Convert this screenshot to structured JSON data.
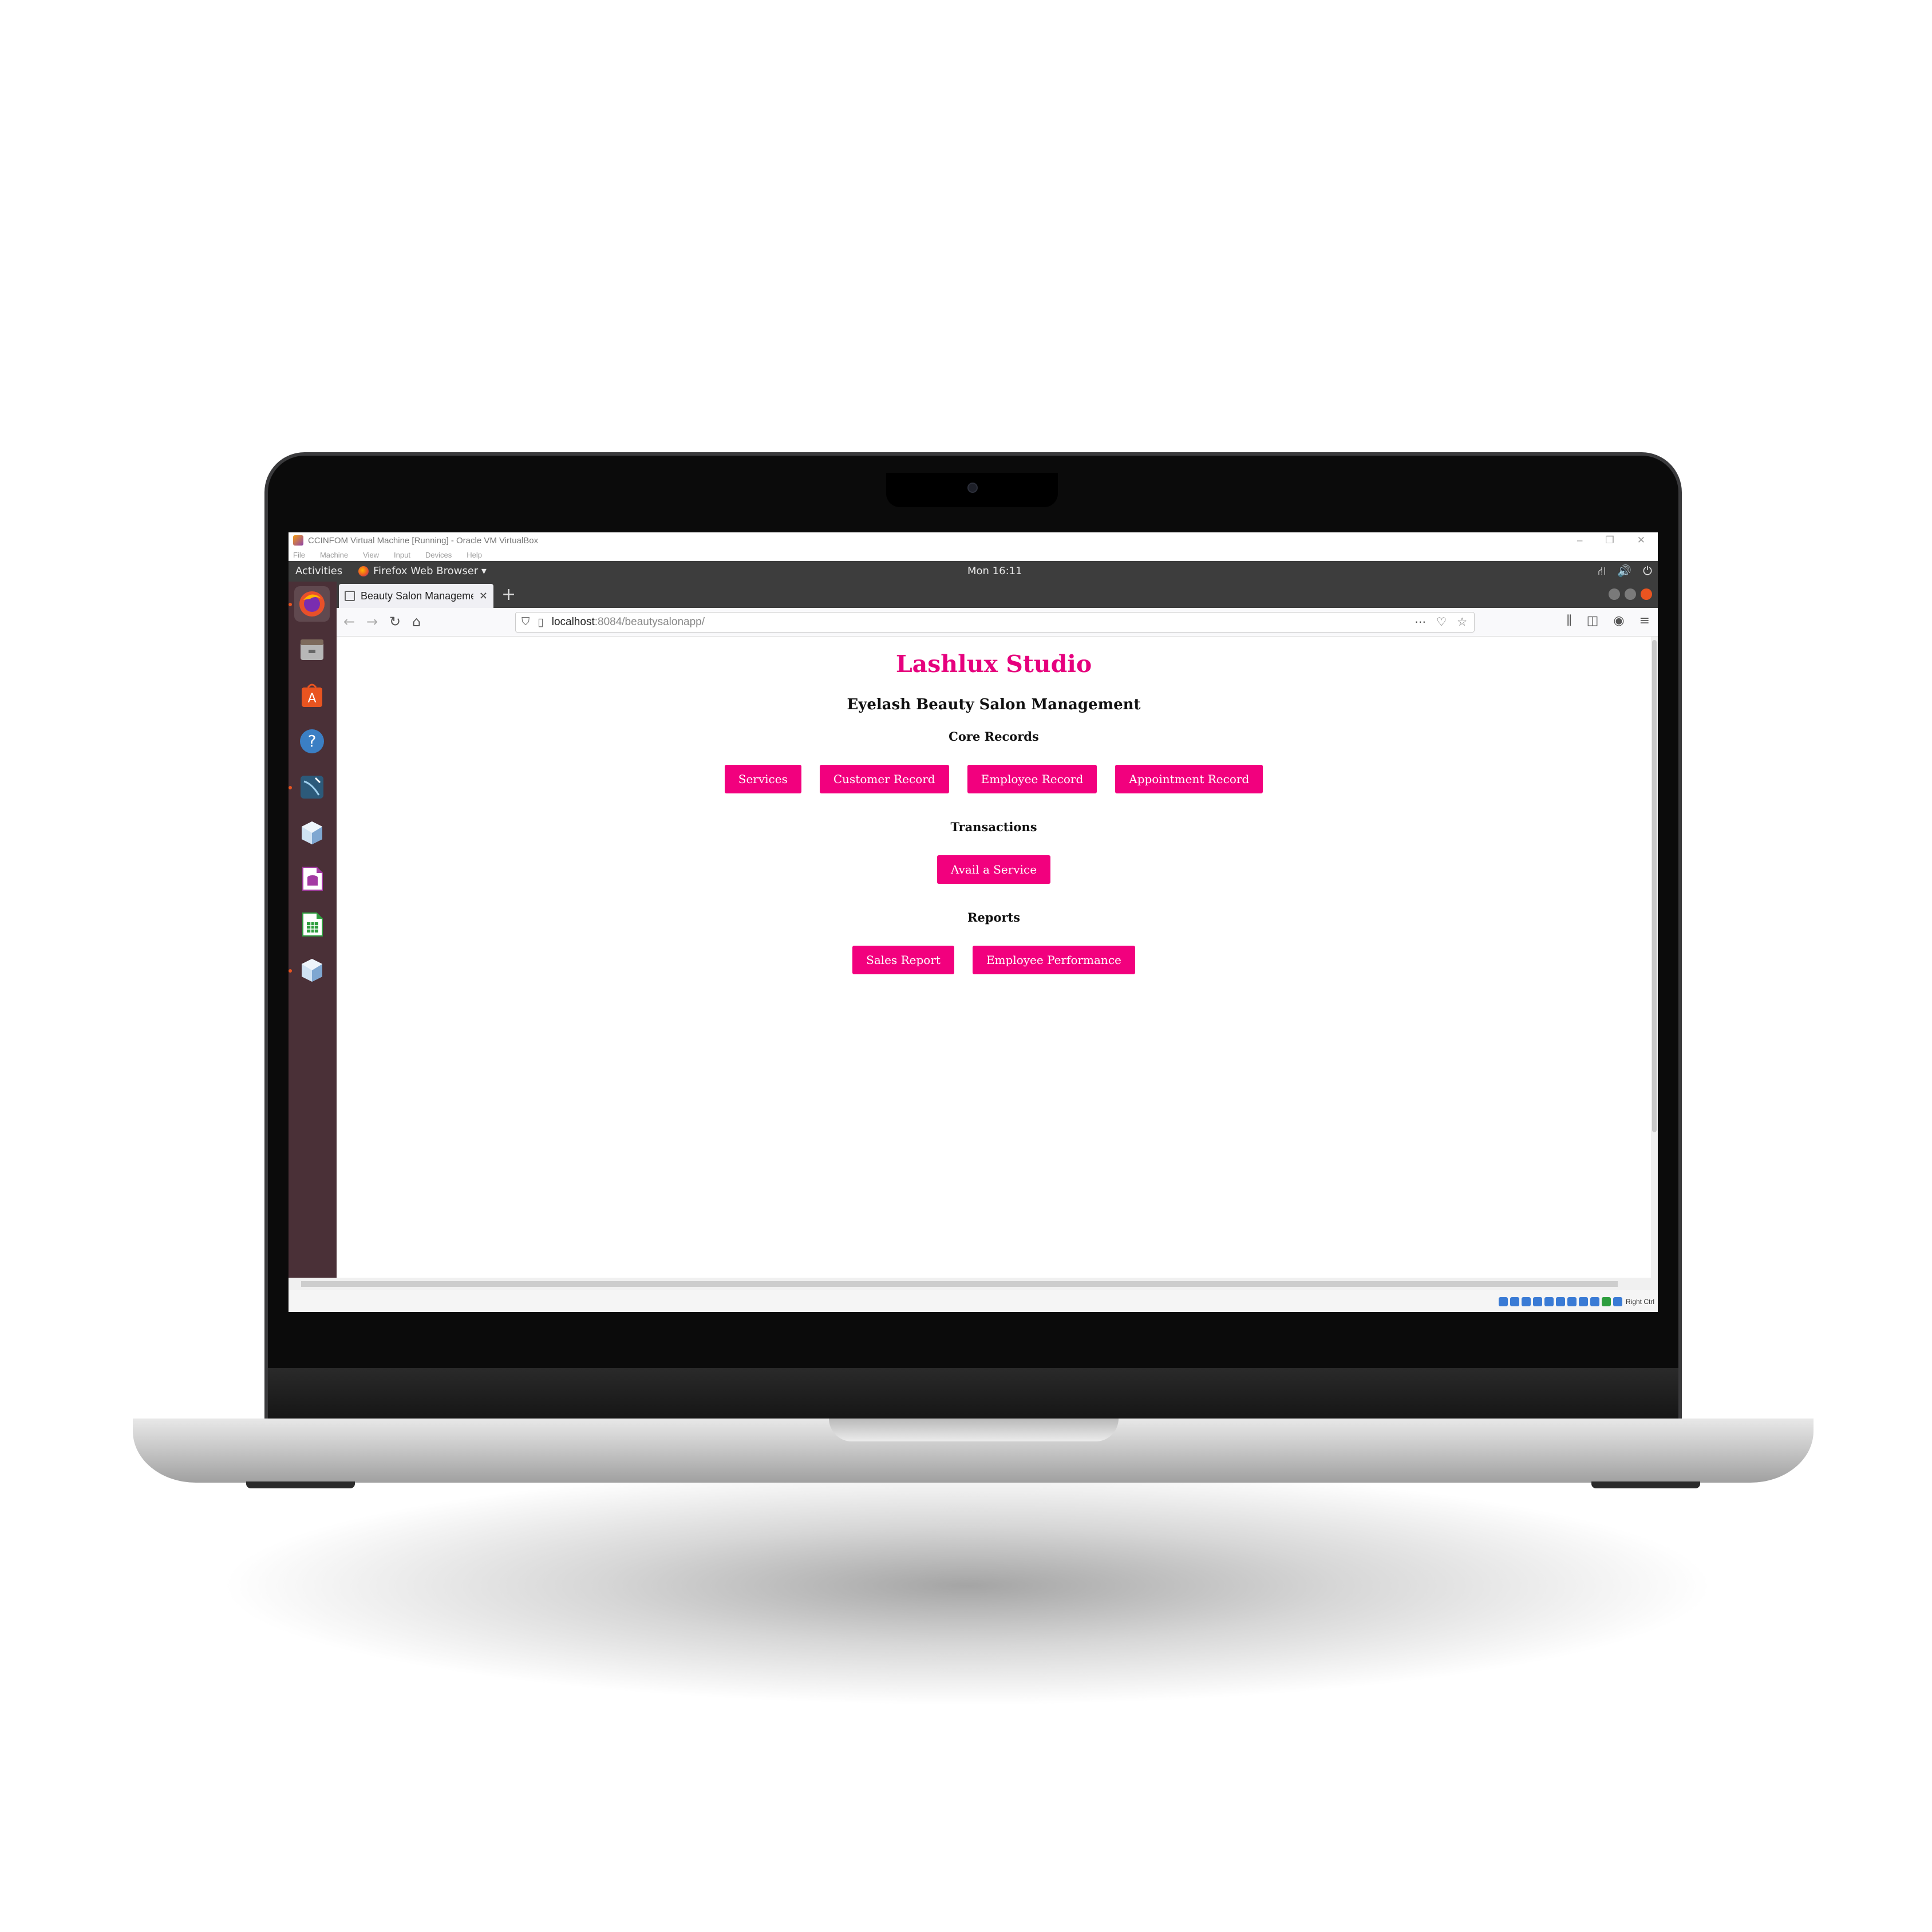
{
  "vbox": {
    "window_title": "CCINFOM Virtual Machine [Running] - Oracle VM VirtualBox",
    "menu": [
      "File",
      "Machine",
      "View",
      "Input",
      "Devices",
      "Help"
    ],
    "host_key": "Right Ctrl"
  },
  "ubuntu": {
    "activities": "Activities",
    "app_menu": "Firefox Web Browser ▾",
    "clock": "Mon 16:11"
  },
  "firefox": {
    "tab_title": "Beauty Salon Manageme",
    "url_host": "localhost",
    "url_path": ":8084/beautysalonapp/"
  },
  "page": {
    "title": "Lashlux Studio",
    "subtitle": "Eyelash Beauty Salon Management",
    "sections": [
      {
        "heading": "Core Records",
        "buttons": [
          "Services",
          "Customer Record",
          "Employee Record",
          "Appointment Record"
        ]
      },
      {
        "heading": "Transactions",
        "buttons": [
          "Avail a Service"
        ]
      },
      {
        "heading": "Reports",
        "buttons": [
          "Sales Report",
          "Employee Performance"
        ]
      }
    ]
  },
  "colors": {
    "accent": "#e6007e",
    "button": "#f2007e",
    "dock": "#4a3037",
    "panel": "#3d3d3d"
  }
}
